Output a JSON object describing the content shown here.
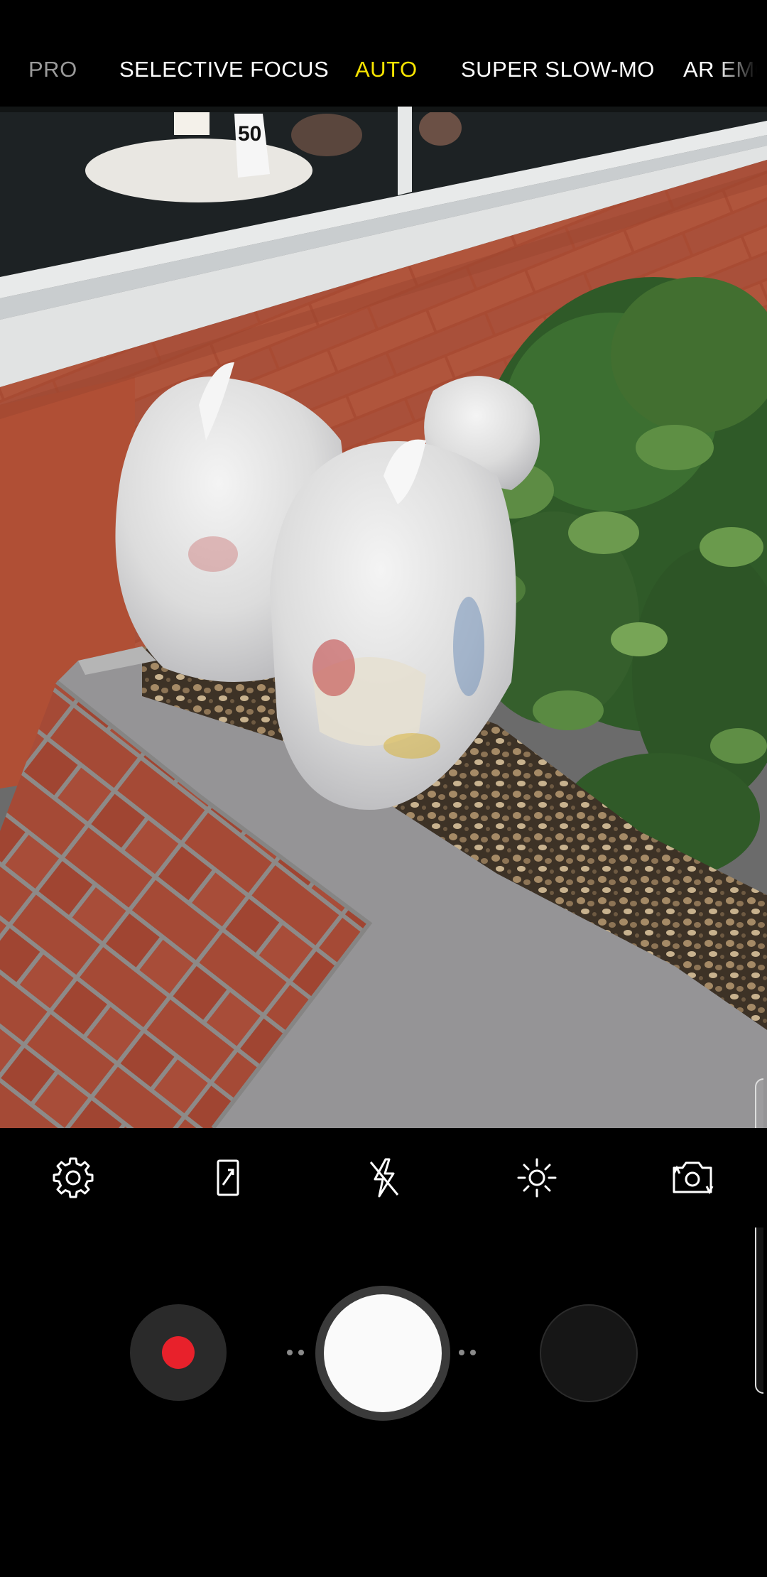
{
  "camera_modes": [
    {
      "label": "PRO",
      "state": "partial"
    },
    {
      "label": "SELECTIVE FOCUS",
      "state": "normal"
    },
    {
      "label": "AUTO",
      "state": "active"
    },
    {
      "label": "SUPER SLOW-MO",
      "state": "normal"
    },
    {
      "label": "AR EMO",
      "state": "partial"
    }
  ],
  "viewfinder": {
    "table_number": "50"
  },
  "quick_settings": [
    {
      "icon": "gear-icon",
      "name": "settings"
    },
    {
      "icon": "aspect-ratio-icon",
      "name": "aspect-ratio"
    },
    {
      "icon": "flash-off-icon",
      "name": "flash"
    },
    {
      "icon": "filter-effects-icon",
      "name": "effects"
    },
    {
      "icon": "switch-camera-icon",
      "name": "switch-camera"
    }
  ],
  "controls": {
    "record_icon": "record-icon",
    "shutter_icon": "shutter-button",
    "gallery_icon": "gallery-thumbnail"
  },
  "colors": {
    "active_mode": "#f7e400",
    "record": "#e8212b",
    "background": "#000000"
  }
}
